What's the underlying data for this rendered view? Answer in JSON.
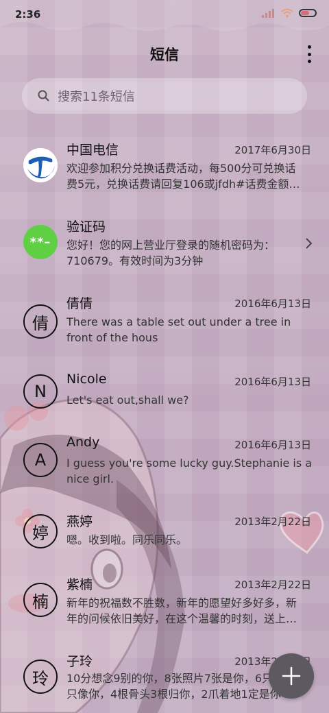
{
  "status": {
    "time": "2:36"
  },
  "header": {
    "title": "短信"
  },
  "search": {
    "placeholder": "搜索11条短信"
  },
  "conversations": [
    {
      "avatar_type": "telecom-logo",
      "name": "中国电信",
      "date": "2017年6月30日",
      "preview": "欢迎参加积分兑换话费活动，每500分可兑换话\n费5元，兑换话费请回复106或jfdh#话费金额…"
    },
    {
      "avatar_type": "code",
      "avatar_text": "**–",
      "name": "验证码",
      "date": "",
      "preview": "您好！您的网上营业厅登录的随机密码为：\n710679。有效时间为3分钟",
      "has_chevron": true
    },
    {
      "avatar_text": "倩",
      "name": "倩倩",
      "date": "2016年6月13日",
      "preview": "There was a table set out under a tree in\nfront of the hous"
    },
    {
      "avatar_text": "N",
      "name": "Nicole",
      "date": "2016年6月13日",
      "preview": "Let's eat out,shall we?"
    },
    {
      "avatar_text": "A",
      "name": "Andy",
      "date": "2016年6月13日",
      "preview": "I guess you're some lucky guy.Stephanie is a\nnice girl."
    },
    {
      "avatar_text": "婷",
      "name": "燕婷",
      "date": "2013年2月22日",
      "preview": "嗯。收到啦。同乐同乐。"
    },
    {
      "avatar_text": "楠",
      "name": "紫楠",
      "date": "2013年2月22日",
      "preview": "新年的祝福数不胜数，新年的愿望好多好多，新\n年的问候依旧美好，在这个温馨的时刻，送上…"
    },
    {
      "avatar_text": "玲",
      "name": "子玲",
      "date": "2013年2月22日",
      "preview": "10分想念9别的你，8张照片7张是你，6只\n只像你，4根骨头3根归你，2爪着地1定是你"
    }
  ],
  "colors": {
    "wallpaper": "#c8b3c6",
    "fab": "#5c5961",
    "code_avatar": "#5fcf44",
    "telecom_blue": "#1d5fb4"
  },
  "icons": {
    "search": "search-icon",
    "more": "more-vertical-icon",
    "add": "plus-icon",
    "chevron": "chevron-right-icon"
  }
}
